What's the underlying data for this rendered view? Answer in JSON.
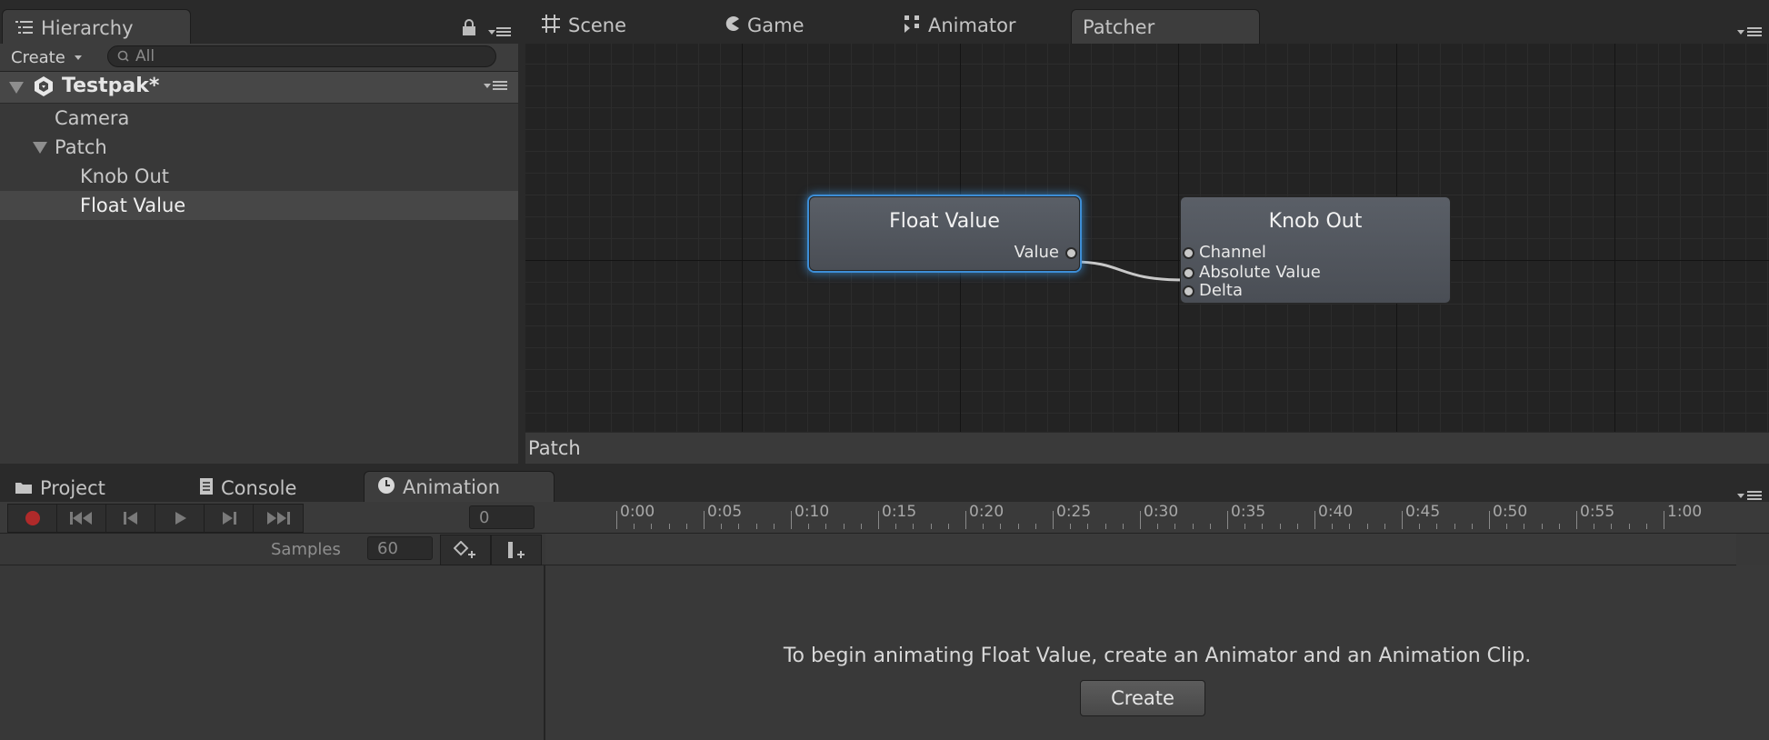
{
  "top_tabs": {
    "hierarchy": "Hierarchy",
    "scene": "Scene",
    "game": "Game",
    "animator": "Animator",
    "patcher": "Patcher"
  },
  "hierarchy": {
    "create_label": "Create",
    "search_placeholder": "All",
    "scene_name": "Testpak*",
    "items": [
      {
        "label": "Camera"
      },
      {
        "label": "Patch"
      },
      {
        "label": "Knob Out"
      },
      {
        "label": "Float Value"
      }
    ]
  },
  "graph": {
    "breadcrumb": "Patch",
    "nodes": {
      "float_value": {
        "title": "Float Value",
        "output": "Value"
      },
      "knob_out": {
        "title": "Knob Out",
        "inputs": [
          "Channel",
          "Absolute Value",
          "Delta"
        ]
      }
    }
  },
  "bottom_tabs": {
    "project": "Project",
    "console": "Console",
    "animation": "Animation"
  },
  "animation": {
    "frame_value": "0",
    "samples_label": "Samples",
    "samples_value": "60",
    "timeline_ticks": [
      "0:00",
      "0:05",
      "0:10",
      "0:15",
      "0:20",
      "0:25",
      "0:30",
      "0:35",
      "0:40",
      "0:45",
      "0:50",
      "0:55",
      "1:00"
    ],
    "message": "To begin animating Float Value, create an Animator and an Animation Clip.",
    "create_button": "Create"
  },
  "colors": {
    "selection_glow": "#3d8ed6",
    "record_button": "#b02a2a"
  }
}
